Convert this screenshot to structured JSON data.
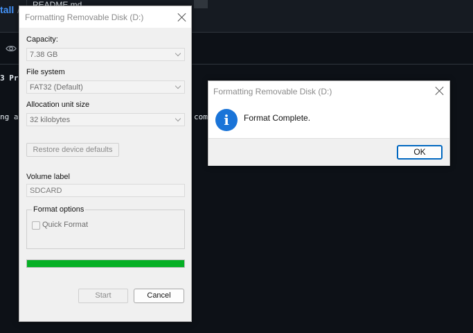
{
  "background": {
    "breadcrumb": "tall",
    "breadcrumb_sep": "/",
    "tab_label": "README.md",
    "code_line_1": "3 Pr",
    "code_line_2": "ng a",
    "code_line_3": "comp"
  },
  "format_dialog": {
    "title": "Formatting Removable Disk (D:)",
    "capacity_label": "Capacity:",
    "capacity_value": "7.38 GB",
    "filesystem_label": "File system",
    "filesystem_value": "FAT32 (Default)",
    "allocation_label": "Allocation unit size",
    "allocation_value": "32 kilobytes",
    "restore_button": "Restore device defaults",
    "volume_label_label": "Volume label",
    "volume_label_value": "SDCARD",
    "format_options_label": "Format options",
    "quick_format_label": "Quick Format",
    "quick_format_checked": false,
    "progress_fraction": 1.0,
    "progress_color": "#06b025",
    "start_button": "Start",
    "cancel_button": "Cancel"
  },
  "message_box": {
    "title": "Formatting Removable Disk (D:)",
    "icon": "info-icon",
    "icon_glyph": "i",
    "message": "Format Complete.",
    "ok_button": "OK"
  }
}
